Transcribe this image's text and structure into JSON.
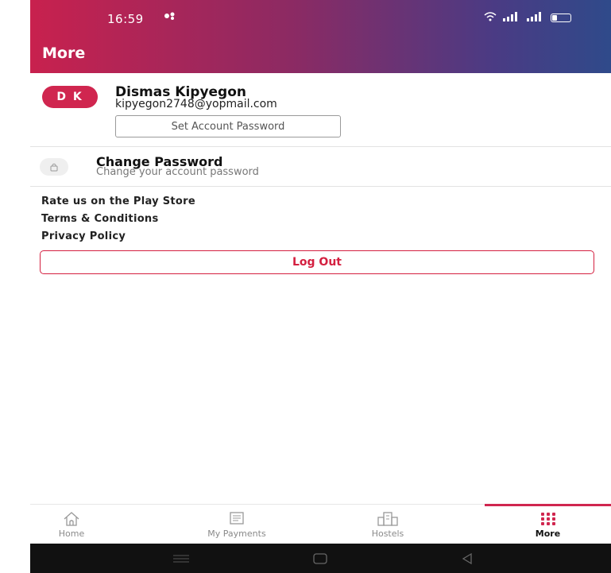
{
  "status_bar": {
    "time": "16:59",
    "right_text": "·✧ ≈ ⌇ …ıl …ıl"
  },
  "header": {
    "title": "More"
  },
  "profile": {
    "initials": "D K",
    "name": "Dismas Kipyegon",
    "email": "kipyegon2748@yopmail.com",
    "set_password_label": "Set Account Password"
  },
  "change_password": {
    "title": "Change Password",
    "subtitle": "Change your account password"
  },
  "links": [
    {
      "label": "Rate us on the Play Store"
    },
    {
      "label": "Terms & Conditions"
    },
    {
      "label": "Privacy Policy"
    }
  ],
  "logout_label": "Log Out",
  "bottom_nav": [
    {
      "label": "Home",
      "icon": "home-icon"
    },
    {
      "label": "My Payments",
      "icon": "receipt-icon"
    },
    {
      "label": "Hostels",
      "icon": "building-icon"
    },
    {
      "label": "More",
      "icon": "grid-dots-icon",
      "active": true
    }
  ],
  "colors": {
    "accent": "#d0264f",
    "header_start": "#c8214e",
    "header_end": "#2f4a8a",
    "logout": "#d42040"
  }
}
